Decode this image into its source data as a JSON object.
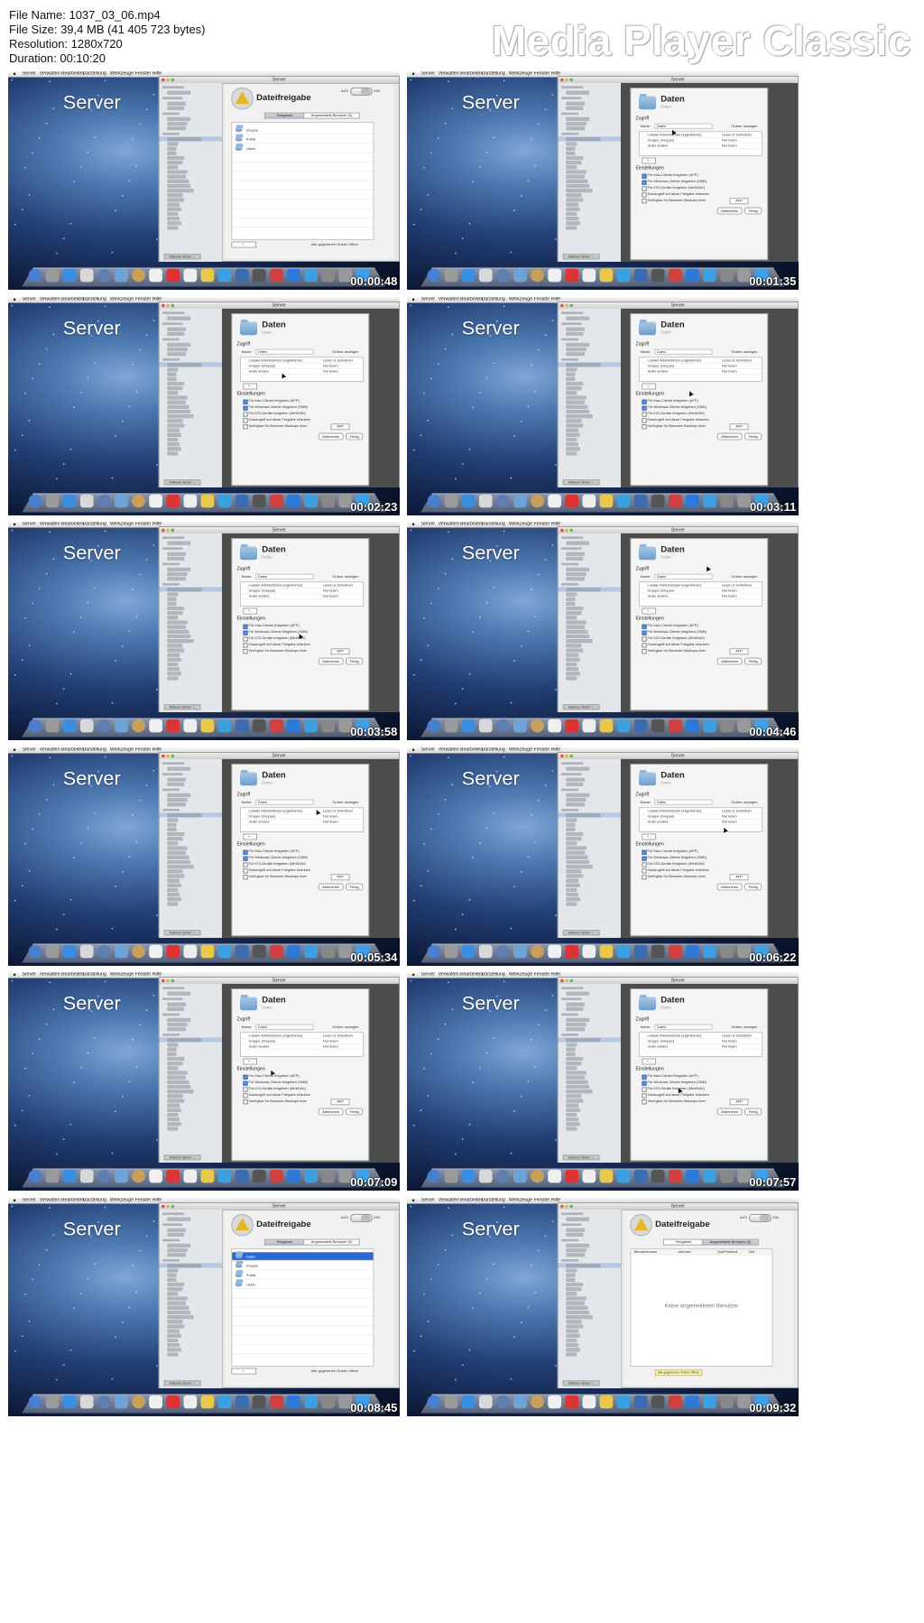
{
  "header": {
    "file_name": "File Name: 1037_03_06.mp4",
    "file_size": "File Size: 39,4 MB (41 405 723 bytes)",
    "resolution": "Resolution: 1280x720",
    "duration": "Duration: 00:10:20",
    "player_name": "Media Player Classic"
  },
  "menubar": [
    "Server",
    "Verwalten",
    "Bearbeiten",
    "Darstellung",
    "Werkzeuge",
    "Fenster",
    "Hilfe"
  ],
  "desktop_label": "Server",
  "window_title": "Server",
  "sidebar_footer": "Aktionen Sehen ↑↓",
  "file_sharing": {
    "title": "Dateifreigabe",
    "toggle_off": "AUS",
    "toggle_on": "EIN",
    "tab_shares": "Freigaben",
    "tab_users": "Angemeldete Benutzer (0)",
    "folders": [
      "Daten",
      "Gruppe",
      "Public",
      "Users"
    ],
    "folders_before": [
      "Gruppe",
      "Public",
      "Users"
    ],
    "footer_hint": "Alle gegebenen Ordner öffnen",
    "empty_users": "Keine angemeldeten Benutzer",
    "users_cols": [
      "Benutzername",
      "Adresse",
      "Typ/Protokoll",
      "Zeit"
    ]
  },
  "daten_sheet": {
    "title": "Daten",
    "subtitle": "Daten",
    "access_label": "Zugriff",
    "name_label": "Name:",
    "name_value": "Daten",
    "show_info": "Ordner anzeigen",
    "users": [
      {
        "name": "Lokaler Administrator (eigentümer)",
        "perm": "Lesen & Schreiben"
      },
      {
        "name": "Gruppe (Gruppe)",
        "perm": "Nur lesen"
      },
      {
        "name": "Jeder andere",
        "perm": "Nur lesen"
      }
    ],
    "plus_minus": "+ -",
    "settings_label": "Einstellungen",
    "options": [
      "Für Mac-Clients freigeben (AFP)",
      "Für Windows-Clients freigeben (SMB)",
      "Für iOS-Geräte freigeben (WebDAV)",
      "Gastzugriff auf diese Freigabe erlauben",
      "Verfügbar für Benutzer-Backups über"
    ],
    "backup_select": "AFP",
    "cancel": "Abbrechen",
    "ok": "Fertig"
  },
  "thumbnails": [
    {
      "time": "00:00:48",
      "view": "list"
    },
    {
      "time": "00:01:35",
      "view": "sheet"
    },
    {
      "time": "00:02:23",
      "view": "sheet"
    },
    {
      "time": "00:03:11",
      "view": "sheet"
    },
    {
      "time": "00:03:58",
      "view": "sheet"
    },
    {
      "time": "00:04:46",
      "view": "sheet"
    },
    {
      "time": "00:05:34",
      "view": "sheet"
    },
    {
      "time": "00:06:22",
      "view": "sheet"
    },
    {
      "time": "00:07:09",
      "view": "sheet"
    },
    {
      "time": "00:07:57",
      "view": "sheet"
    },
    {
      "time": "00:08:45",
      "view": "list2"
    },
    {
      "time": "00:09:32",
      "view": "users"
    }
  ],
  "dock_colors": [
    "#4a7fd0",
    "#9a9a9a",
    "#3b8de0",
    "#d8d8d8",
    "#5f7fb0",
    "#6ea3d8",
    "#c9a05a",
    "#f0f0f0",
    "#d33",
    "#eee",
    "#e9c94a",
    "#3aa0e0",
    "#3b6bb0",
    "#555",
    "#d04040",
    "#2e78d8",
    "#3d9fe0",
    "#888",
    "#999",
    "#3da0e8"
  ]
}
